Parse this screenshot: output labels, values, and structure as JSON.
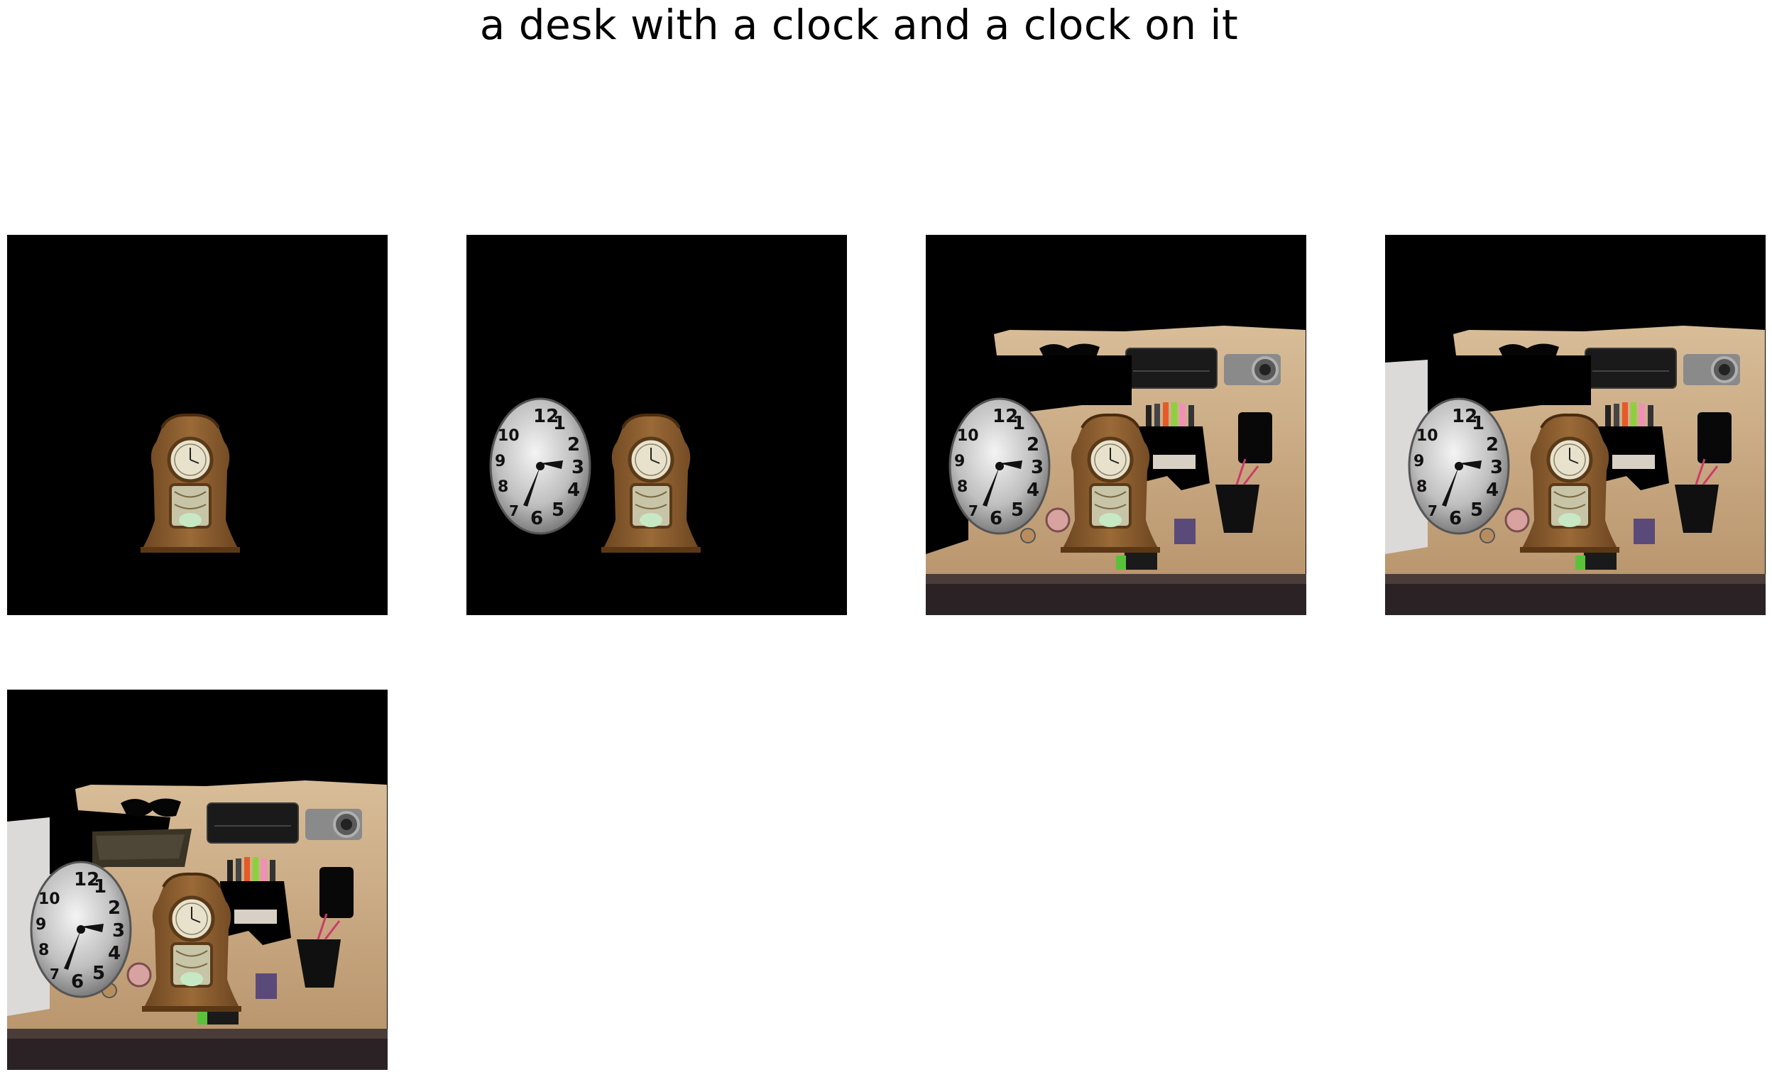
{
  "figure": {
    "title": "a desk with a clock and a clock on it",
    "panel_count": 5,
    "colors": {
      "background": "#000000",
      "desk": "#c9a882",
      "mantel_clock_wood": "#8a5a2b",
      "wall_clock_face": "#d9d9d9"
    },
    "panels": [
      {
        "id": "panel-1",
        "content": [
          "mantel-clock"
        ]
      },
      {
        "id": "panel-2",
        "content": [
          "wall-clock",
          "mantel-clock"
        ]
      },
      {
        "id": "panel-3",
        "content": [
          "wall-clock",
          "mantel-clock",
          "desk",
          "camera",
          "black-box",
          "markers",
          "cups"
        ]
      },
      {
        "id": "panel-4",
        "content": [
          "wall-clock",
          "mantel-clock",
          "desk",
          "camera",
          "black-box",
          "markers",
          "cups",
          "wall-left"
        ]
      },
      {
        "id": "panel-5",
        "content": [
          "wall-clock",
          "mantel-clock",
          "desk",
          "camera",
          "black-box",
          "markers",
          "cups",
          "wall-left",
          "dark-patch"
        ]
      }
    ]
  }
}
